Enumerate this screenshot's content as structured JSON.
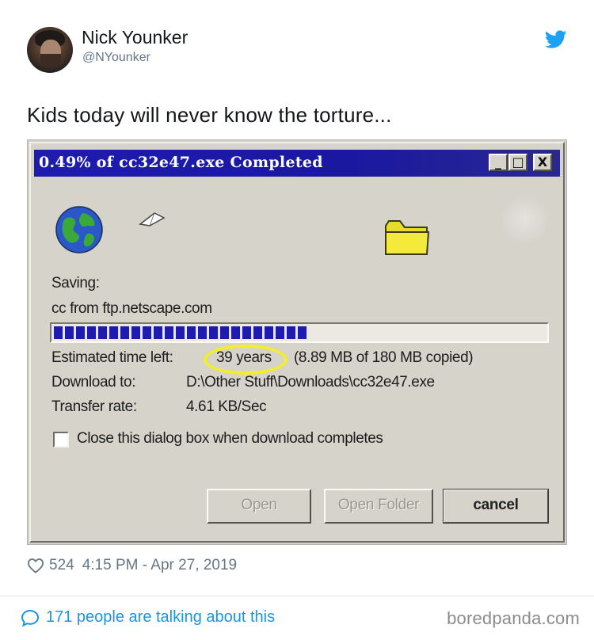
{
  "tweet": {
    "author_name": "Nick Younker",
    "author_handle": "@NYounker",
    "text": "Kids today will never know the torture...",
    "likes": "524",
    "timestamp": "4:15 PM - Apr 27, 2019",
    "talking": "171 people are talking about this",
    "icons": {
      "brand": "twitter-bird-icon",
      "like": "heart-icon",
      "reply": "speech-bubble-icon"
    },
    "colors": {
      "link": "#1b95e0",
      "muted": "#657786"
    }
  },
  "dialog": {
    "title": "0.49% of cc32e47.exe Completed",
    "title_buttons": [
      "_",
      "□",
      "X"
    ],
    "saving_label": "Saving:",
    "source": "cc from ftp.netscape.com",
    "progress_fraction": 0.0049,
    "estimated_label": "Estimated time left:",
    "estimated_value": "39 years",
    "estimated_copied": "(8.89 MB of 180 MB copied)",
    "download_label": "Download to:",
    "download_path": "D:\\Other Stuff\\Downloads\\cc32e47.exe",
    "rate_label": "Transfer rate:",
    "rate_value": "4.61 KB/Sec",
    "checkbox_label": "Close this dialog box when download completes",
    "checkbox_checked": false,
    "buttons": {
      "open": "Open",
      "open_folder": "Open Folder",
      "cancel": "cancel"
    },
    "colors": {
      "titlebar": "#1e1bb0",
      "progress": "#1e1bb0",
      "highlight": "#f2ee2a"
    }
  },
  "watermark": "boredpanda.com"
}
